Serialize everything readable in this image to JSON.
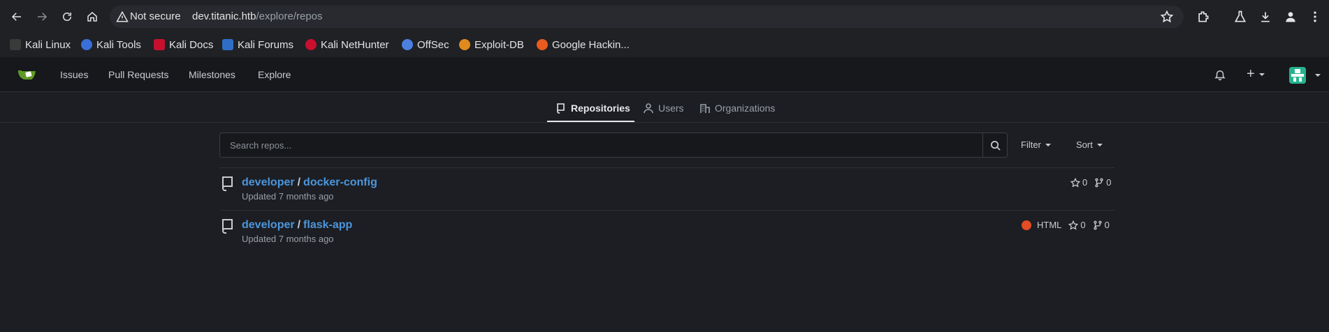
{
  "browser": {
    "security_label": "Not secure",
    "url_host": "dev.titanic.htb",
    "url_path": "/explore/repos",
    "bookmarks": [
      {
        "label": "Kali Linux",
        "color": "#2a2a2a"
      },
      {
        "label": "Kali Tools",
        "color": "#3a6fd8"
      },
      {
        "label": "Kali Docs",
        "color": "#c8102e"
      },
      {
        "label": "Kali Forums",
        "color": "#2f6ec7"
      },
      {
        "label": "Kali NetHunter",
        "color": "#c8102e"
      },
      {
        "label": "OffSec",
        "color": "#4d7fe0"
      },
      {
        "label": "Exploit-DB",
        "color": "#e08a1e"
      },
      {
        "label": "Google Hackin...",
        "color": "#e85a1e"
      }
    ]
  },
  "header": {
    "nav": [
      {
        "label": "Issues"
      },
      {
        "label": "Pull Requests"
      },
      {
        "label": "Milestones"
      },
      {
        "label": "Explore"
      }
    ],
    "plus_label": "+"
  },
  "tabs": {
    "repositories": "Repositories",
    "users": "Users",
    "organizations": "Organizations"
  },
  "search": {
    "placeholder": "Search repos...",
    "filter_label": "Filter",
    "sort_label": "Sort"
  },
  "repos": [
    {
      "owner": "developer",
      "name": "docker-config",
      "updated": "Updated 7 months ago",
      "language": "",
      "stars": "0",
      "forks": "0"
    },
    {
      "owner": "developer",
      "name": "flask-app",
      "updated": "Updated 7 months ago",
      "language": "HTML",
      "language_color": "#e34c26",
      "stars": "0",
      "forks": "0"
    }
  ],
  "colors": {
    "accent_link": "#4c96dd",
    "gitea_green": "#609926",
    "background": "#1c1e23"
  }
}
